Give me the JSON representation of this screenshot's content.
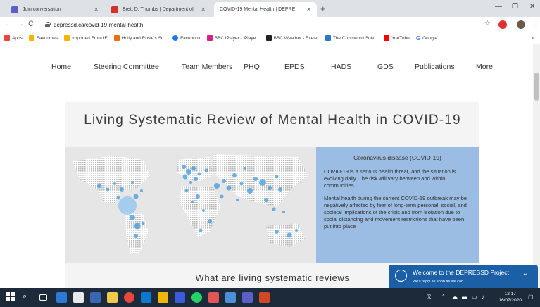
{
  "browser": {
    "tabs": [
      {
        "title": "Join conversation",
        "favicon_color": "#5b5fc7"
      },
      {
        "title": "Brett D. Thombs | Department of",
        "favicon_color": "#d0312d"
      },
      {
        "title": "COVID-19 Mental Health | DEPRE",
        "favicon_color": "#ffffff"
      }
    ],
    "active_tab_index": 2,
    "url": "depressd.ca/covid-19-mental-health",
    "bookmarks": [
      {
        "label": "Apps",
        "color": "#e8453c"
      },
      {
        "label": "Favourites",
        "color": "#f4b400"
      },
      {
        "label": "Imported From IE",
        "color": "#f4b400"
      },
      {
        "label": "Holly and Rosie's St...",
        "color": "#e8710a"
      },
      {
        "label": "Facebook",
        "color": "#1877f2"
      },
      {
        "label": "BBC iPlayer - iPlaye...",
        "color": "#d6208a"
      },
      {
        "label": "BBC Weather - Exeter",
        "color": "#222222"
      },
      {
        "label": "The Crossword Solv...",
        "color": "#2b79c2"
      },
      {
        "label": "YouTube",
        "color": "#ff0000"
      },
      {
        "label": "Google",
        "color": "#4285f4"
      }
    ],
    "more_bookmarks": "»"
  },
  "site_nav": [
    "Home",
    "Steering Committee",
    "Team Members",
    "PHQ",
    "EPDS",
    "HADS",
    "GDS",
    "Publications",
    "More"
  ],
  "main": {
    "title": "Living Systematic Review of Mental Health in COVID-19",
    "info_link": "Coronavirus disease (COVID-19)",
    "paragraph1": "COVID-19 is a serious health threat, and the situation is evolving daily. The risk will vary between and within communities.",
    "paragraph2": "Mental health during the current COVID-19 outbreak may be negatively affected by fear of long-term personal, social, and societal implications of the crisis and from isolation due to social distancing and movement restrictions that have been put into place",
    "subheading": "What are living systematic reviews"
  },
  "chat": {
    "title": "Welcome to the DEPRESSD Project",
    "subtitle": "We'll reply as soon as we can",
    "color": "#1b5fa6"
  },
  "taskbar": {
    "time": "12:17",
    "date": "16/07/2020"
  }
}
